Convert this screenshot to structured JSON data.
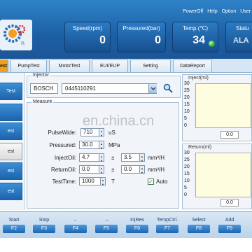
{
  "topmenu": [
    "PowerOff",
    "Help",
    "Option",
    "User"
  ],
  "gauges": {
    "speed": {
      "label": "Speed(rpm)",
      "value": "0"
    },
    "pressure": {
      "label": "Pressured(bar)",
      "value": "0"
    },
    "temp": {
      "label": "Temp.(℃)",
      "value": "34"
    },
    "status": {
      "label": "Statu",
      "value": "ALA"
    }
  },
  "tabs": [
    {
      "label": "est",
      "active": true
    },
    {
      "label": "PumpTest"
    },
    {
      "label": "MotorTest"
    },
    {
      "label": "EUI/EUP"
    },
    {
      "label": "Setting"
    },
    {
      "label": "DataReport"
    }
  ],
  "leftnav": [
    "Test",
    "",
    "est",
    "est",
    "est",
    "est"
  ],
  "injector": {
    "legend": "Injector",
    "brand": "BOSCH",
    "number": "0445110291"
  },
  "measure": {
    "legend": "Measure",
    "pulsewide": {
      "label": "PulseWide:",
      "value": "710",
      "unit": "uS"
    },
    "pressured": {
      "label": "Pressured:",
      "value": "30.0",
      "unit": "MPa"
    },
    "injectoil": {
      "label": "InjectOil:",
      "value": "4.7",
      "pm": "±",
      "tol": "3.5",
      "unit": "mm³/H"
    },
    "returnoil": {
      "label": "ReturnOil:",
      "value": "0.0",
      "pm": "±",
      "tol": "0.0",
      "unit": "mm³/H"
    },
    "testtime": {
      "label": "TestTime:",
      "value": "1000",
      "unit": "T"
    },
    "auto": {
      "label": "Auto",
      "checked": true
    }
  },
  "watermark": "en.china.cn",
  "charts": {
    "inject": {
      "title": "Inject(ml)",
      "ticks": [
        "30",
        "25",
        "20",
        "15",
        "10",
        "5",
        "0"
      ],
      "value": "0.0"
    },
    "return": {
      "title": "Return(ml)",
      "ticks": [
        "30",
        "25",
        "20",
        "15",
        "10",
        "5",
        "0"
      ],
      "value": "0.0"
    }
  },
  "fkeys": [
    {
      "name": "Start",
      "code": "F2"
    },
    {
      "name": "Stop",
      "code": "F3"
    },
    {
      "name": "←",
      "code": "F4"
    },
    {
      "name": "→",
      "code": "F5"
    },
    {
      "name": "InjRes",
      "code": "F6"
    },
    {
      "name": "TempCtrl.",
      "code": "F7"
    },
    {
      "name": "Select",
      "code": "F8"
    },
    {
      "name": "Add",
      "code": "F9"
    }
  ],
  "colors": {
    "header": "#1d5fa4",
    "active_tab": "#f0a020",
    "plot_bg": "#fffde0",
    "led": "#1e9c23"
  }
}
